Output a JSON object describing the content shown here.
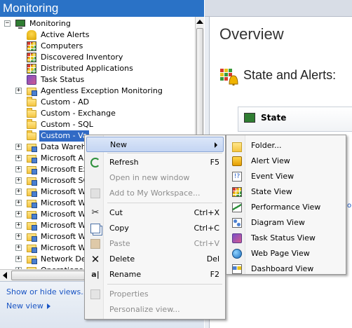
{
  "left_pane": {
    "title": "Monitoring",
    "tree": [
      {
        "label": "Monitoring",
        "icon": "monitor-icon",
        "expander": "−"
      },
      {
        "label": "Active Alerts",
        "icon": "bell-icon"
      },
      {
        "label": "Computers",
        "icon": "state-grid-icon"
      },
      {
        "label": "Discovered Inventory",
        "icon": "state-grid-icon"
      },
      {
        "label": "Distributed Applications",
        "icon": "state-grid-icon"
      },
      {
        "label": "Task Status",
        "icon": "task-status-icon"
      },
      {
        "label": "Agentless Exception Monitoring",
        "icon": "folder-view-icon",
        "expander": "+"
      },
      {
        "label": "Custom - AD",
        "icon": "folder-icon"
      },
      {
        "label": "Custom - Exchange",
        "icon": "folder-icon"
      },
      {
        "label": "Custom - SQL",
        "icon": "folder-icon"
      },
      {
        "label": "Custom - Va",
        "icon": "folder-icon",
        "selected": true
      },
      {
        "label": "Data Wareh",
        "icon": "folder-view-icon",
        "expander": "+"
      },
      {
        "label": "Microsoft Au",
        "icon": "folder-view-icon",
        "expander": "+"
      },
      {
        "label": "Microsoft Ex",
        "icon": "folder-view-icon",
        "expander": "+"
      },
      {
        "label": "Microsoft SQ",
        "icon": "folder-view-icon",
        "expander": "+"
      },
      {
        "label": "Microsoft Wi",
        "icon": "folder-view-icon",
        "expander": "+"
      },
      {
        "label": "Microsoft Wi",
        "icon": "folder-view-icon",
        "expander": "+"
      },
      {
        "label": "Microsoft Wi",
        "icon": "folder-view-icon",
        "expander": "+"
      },
      {
        "label": "Microsoft Wi",
        "icon": "folder-view-icon",
        "expander": "+"
      },
      {
        "label": "Microsoft Wi",
        "icon": "folder-view-icon",
        "expander": "+"
      },
      {
        "label": "Microsoft Wi",
        "icon": "folder-view-icon",
        "expander": "+"
      },
      {
        "label": "Network Dev",
        "icon": "folder-view-icon",
        "expander": "+"
      },
      {
        "label": "Operations M",
        "icon": "folder-view-icon",
        "expander": "+"
      }
    ],
    "footer": {
      "show_hide_link": "Show or hide views...",
      "new_view_link": "New view"
    }
  },
  "right_pane": {
    "title": "Overview",
    "section_title": "State and Alerts:",
    "state_card_label": "State",
    "edge_text": "ou"
  },
  "context_menu": {
    "items": [
      {
        "label": "New",
        "key": "",
        "icon": "",
        "submenu": true,
        "highlight": true
      },
      {
        "label": "Refresh",
        "key": "F5",
        "icon": "refresh-icon"
      },
      {
        "label": "Open in new window",
        "key": "",
        "icon": "",
        "disabled": true
      },
      {
        "label": "Add to My Workspace...",
        "key": "",
        "icon": "workspace-icon",
        "disabled": true
      },
      {
        "label": "Cut",
        "key": "Ctrl+X",
        "icon": "scissors-icon"
      },
      {
        "label": "Copy",
        "key": "Ctrl+C",
        "icon": "copy-icon"
      },
      {
        "label": "Paste",
        "key": "Ctrl+V",
        "icon": "paste-icon",
        "disabled": true
      },
      {
        "label": "Delete",
        "key": "Del",
        "icon": "delete-icon"
      },
      {
        "label": "Rename",
        "key": "F2",
        "icon": "rename-icon"
      },
      {
        "label": "Properties",
        "key": "",
        "icon": "properties-icon",
        "disabled": true
      },
      {
        "label": "Personalize view...",
        "key": "",
        "icon": "",
        "disabled": true
      }
    ]
  },
  "sub_menu": {
    "items": [
      {
        "label": "Folder...",
        "icon": "folder-icon"
      },
      {
        "label": "Alert View",
        "icon": "alert-view-icon"
      },
      {
        "label": "Event View",
        "icon": "event-view-icon"
      },
      {
        "label": "State View",
        "icon": "state-view-icon"
      },
      {
        "label": "Performance View",
        "icon": "performance-view-icon"
      },
      {
        "label": "Diagram View",
        "icon": "diagram-view-icon"
      },
      {
        "label": "Task Status View",
        "icon": "task-status-view-icon"
      },
      {
        "label": "Web Page View",
        "icon": "web-page-view-icon"
      },
      {
        "label": "Dashboard View",
        "icon": "dashboard-view-icon"
      }
    ]
  },
  "colors": {
    "header_blue": "#2a72c6",
    "selection_blue": "#316ac5",
    "link_blue": "#1a55c4",
    "menu_highlight": "#c4d5f3"
  }
}
